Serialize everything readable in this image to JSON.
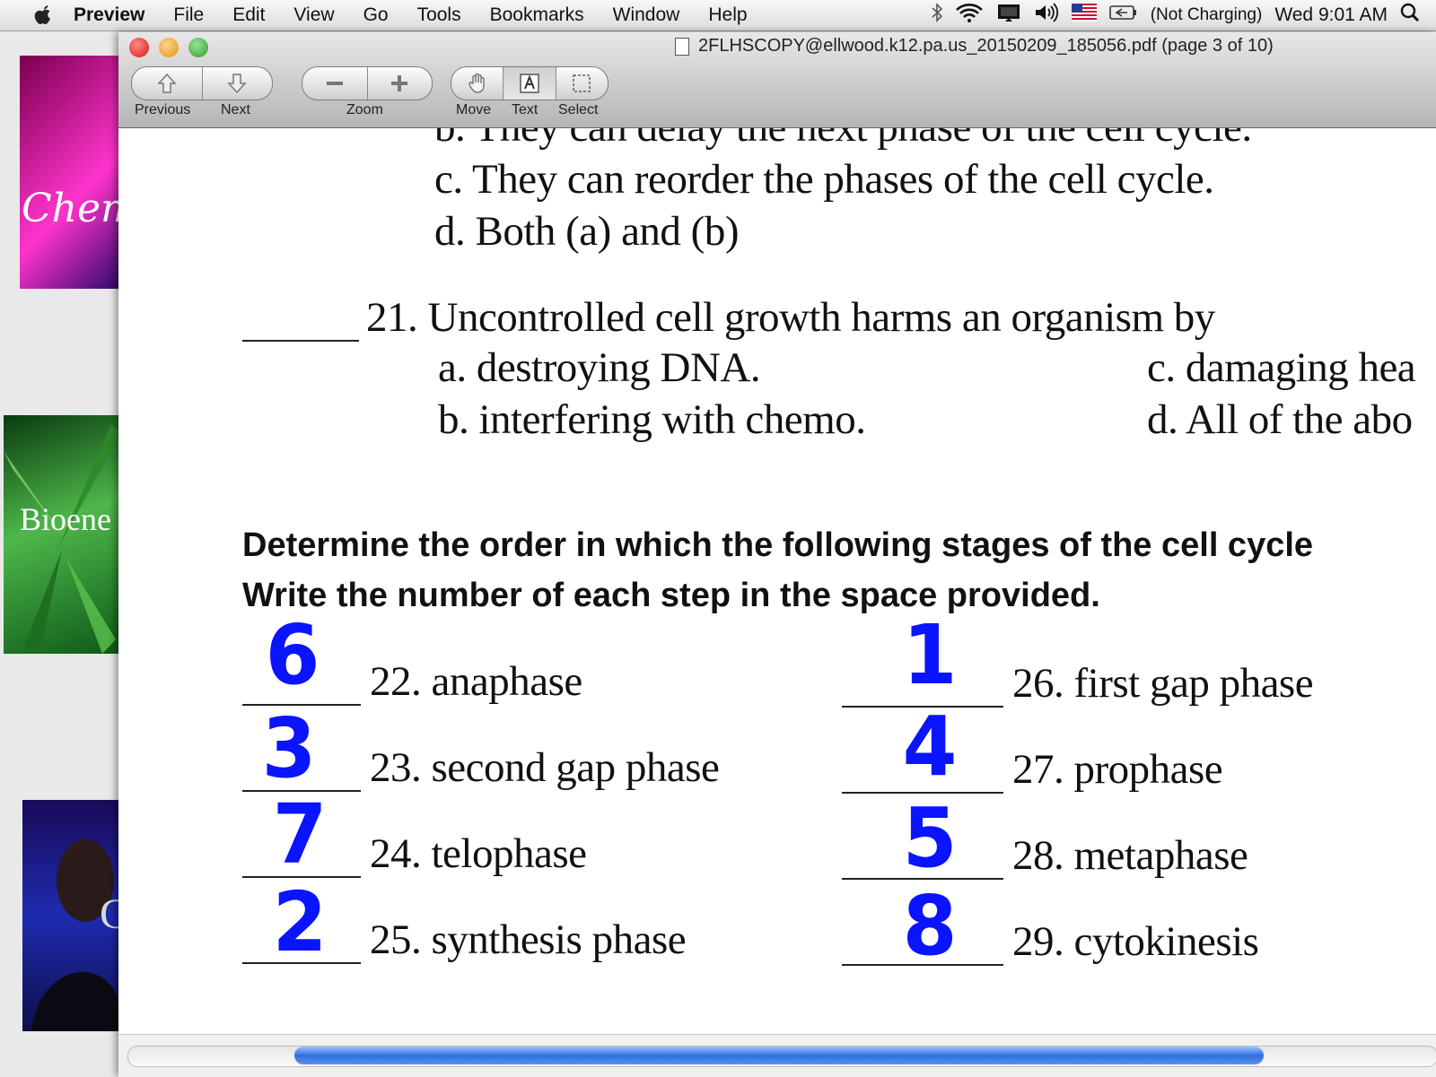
{
  "menubar": {
    "app_name": "Preview",
    "menus": [
      "File",
      "Edit",
      "View",
      "Go",
      "Tools",
      "Bookmarks",
      "Window",
      "Help"
    ],
    "battery_status": "(Not Charging)",
    "clock": "Wed 9:01 AM"
  },
  "desktop": {
    "thumb1_text": "Chem",
    "thumb2_text": "Bioene",
    "thumb3_text": "C"
  },
  "window": {
    "title": "2FLHSCOPY@ellwood.k12.pa.us_20150209_185056.pdf (page 3 of 10)",
    "toolbar": {
      "previous_label": "Previous",
      "next_label": "Next",
      "zoom_label": "Zoom",
      "move_label": "Move",
      "text_label": "Text",
      "select_label": "Select"
    }
  },
  "document": {
    "q20_option_b": "b.  They can delay the next phase of the cell cycle.",
    "q20_option_c": "c.  They can reorder the phases of the cell cycle.",
    "q20_option_d": "d.  Both (a) and (b)",
    "q21_stem": "21. Uncontrolled cell growth harms an organism by",
    "q21_option_a": "a.  destroying DNA.",
    "q21_option_b": "b.  interfering with chemo.",
    "q21_option_c": "c. damaging hea",
    "q21_option_d": "d. All of the abo",
    "instruction_line1": "Determine the order in which the following stages of the cell cycle",
    "instruction_line2": "Write the number of each step in the space provided.",
    "items_left": [
      {
        "label": "22. anaphase",
        "answer": "6"
      },
      {
        "label": "23. second gap phase",
        "answer": "3"
      },
      {
        "label": "24. telophase",
        "answer": "7"
      },
      {
        "label": "25. synthesis phase",
        "answer": "2"
      }
    ],
    "items_right": [
      {
        "label": "26. first gap phase",
        "answer": "1"
      },
      {
        "label": "27. prophase",
        "answer": "4"
      },
      {
        "label": "28. metaphase",
        "answer": "5"
      },
      {
        "label": "29. cytokinesis",
        "answer": "8"
      }
    ]
  }
}
